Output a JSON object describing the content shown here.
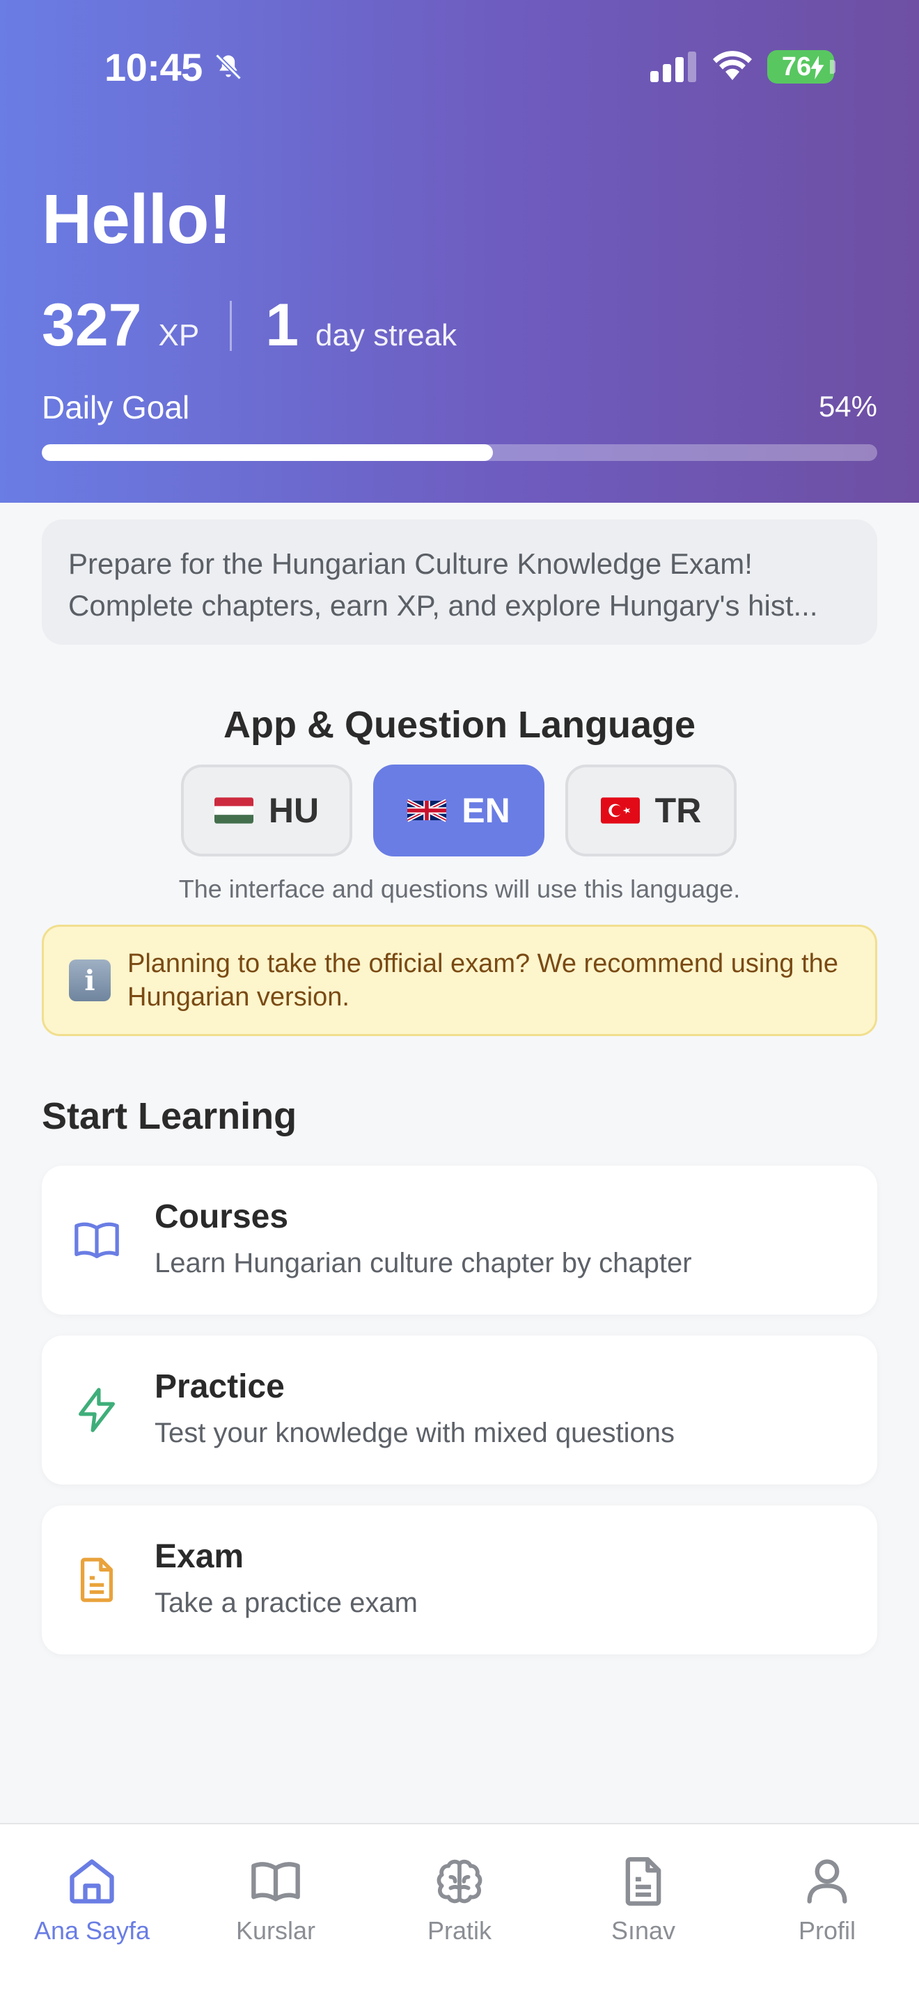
{
  "status_bar": {
    "time": "10:45",
    "battery": "76"
  },
  "header": {
    "greeting": "Hello!",
    "xp_value": "327",
    "xp_label": "XP",
    "streak_value": "1",
    "streak_label": "day streak",
    "daily_goal_label": "Daily Goal",
    "daily_goal_percent": "54%",
    "daily_goal_progress": 0.54
  },
  "intro": {
    "line1": "Prepare for the Hungarian Culture Knowledge Exam!",
    "line2": "Complete chapters, earn XP, and explore Hungary's hist..."
  },
  "language": {
    "title": "App & Question Language",
    "options": [
      {
        "code": "HU",
        "flag": "hungary-flag",
        "selected": false
      },
      {
        "code": "EN",
        "flag": "uk-flag",
        "selected": true
      },
      {
        "code": "TR",
        "flag": "turkey-flag",
        "selected": false
      }
    ],
    "note": "The interface and questions will use this language.",
    "info": "Planning to take the official exam? We recommend using the Hungarian version."
  },
  "learning": {
    "title": "Start Learning",
    "cards": [
      {
        "title": "Courses",
        "desc": "Learn Hungarian culture chapter by chapter",
        "icon": "book-icon",
        "color": "#6a7de4"
      },
      {
        "title": "Practice",
        "desc": "Test your knowledge with mixed questions",
        "icon": "lightning-icon",
        "color": "#3fae7a"
      },
      {
        "title": "Exam",
        "desc": "Take a practice exam",
        "icon": "document-icon",
        "color": "#e9a23b"
      }
    ]
  },
  "tabs": [
    {
      "label": "Ana Sayfa",
      "icon": "home-icon",
      "active": true
    },
    {
      "label": "Kurslar",
      "icon": "book-icon",
      "active": false
    },
    {
      "label": "Pratik",
      "icon": "brain-icon",
      "active": false
    },
    {
      "label": "Sınav",
      "icon": "document-icon",
      "active": false
    },
    {
      "label": "Profil",
      "icon": "user-icon",
      "active": false
    }
  ],
  "colors": {
    "accent": "#6a7de4",
    "header_start": "#6a7de4",
    "header_end": "#6e4fa3"
  }
}
